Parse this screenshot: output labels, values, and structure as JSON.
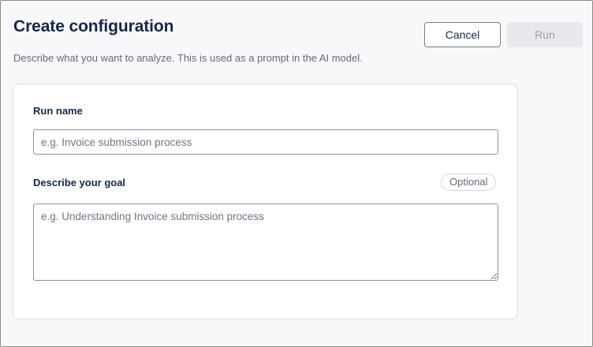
{
  "dialog": {
    "title": "Create configuration",
    "subtitle": "Describe what you want to analyze. This is used as a prompt in the AI model."
  },
  "actions": {
    "cancel_label": "Cancel",
    "run_label": "Run",
    "run_enabled": false
  },
  "form": {
    "run_name": {
      "label": "Run name",
      "value": "",
      "placeholder": "e.g. Invoice submission process"
    },
    "goal": {
      "label": "Describe your goal",
      "badge": "Optional",
      "value": "",
      "placeholder": "e.g. Understanding Invoice submission process"
    }
  },
  "colors": {
    "title_text": "#182646",
    "muted_text": "#636a7c",
    "background": "#f8f8fa",
    "card": "#ffffff",
    "disabled_button": "#e8e9ed"
  }
}
